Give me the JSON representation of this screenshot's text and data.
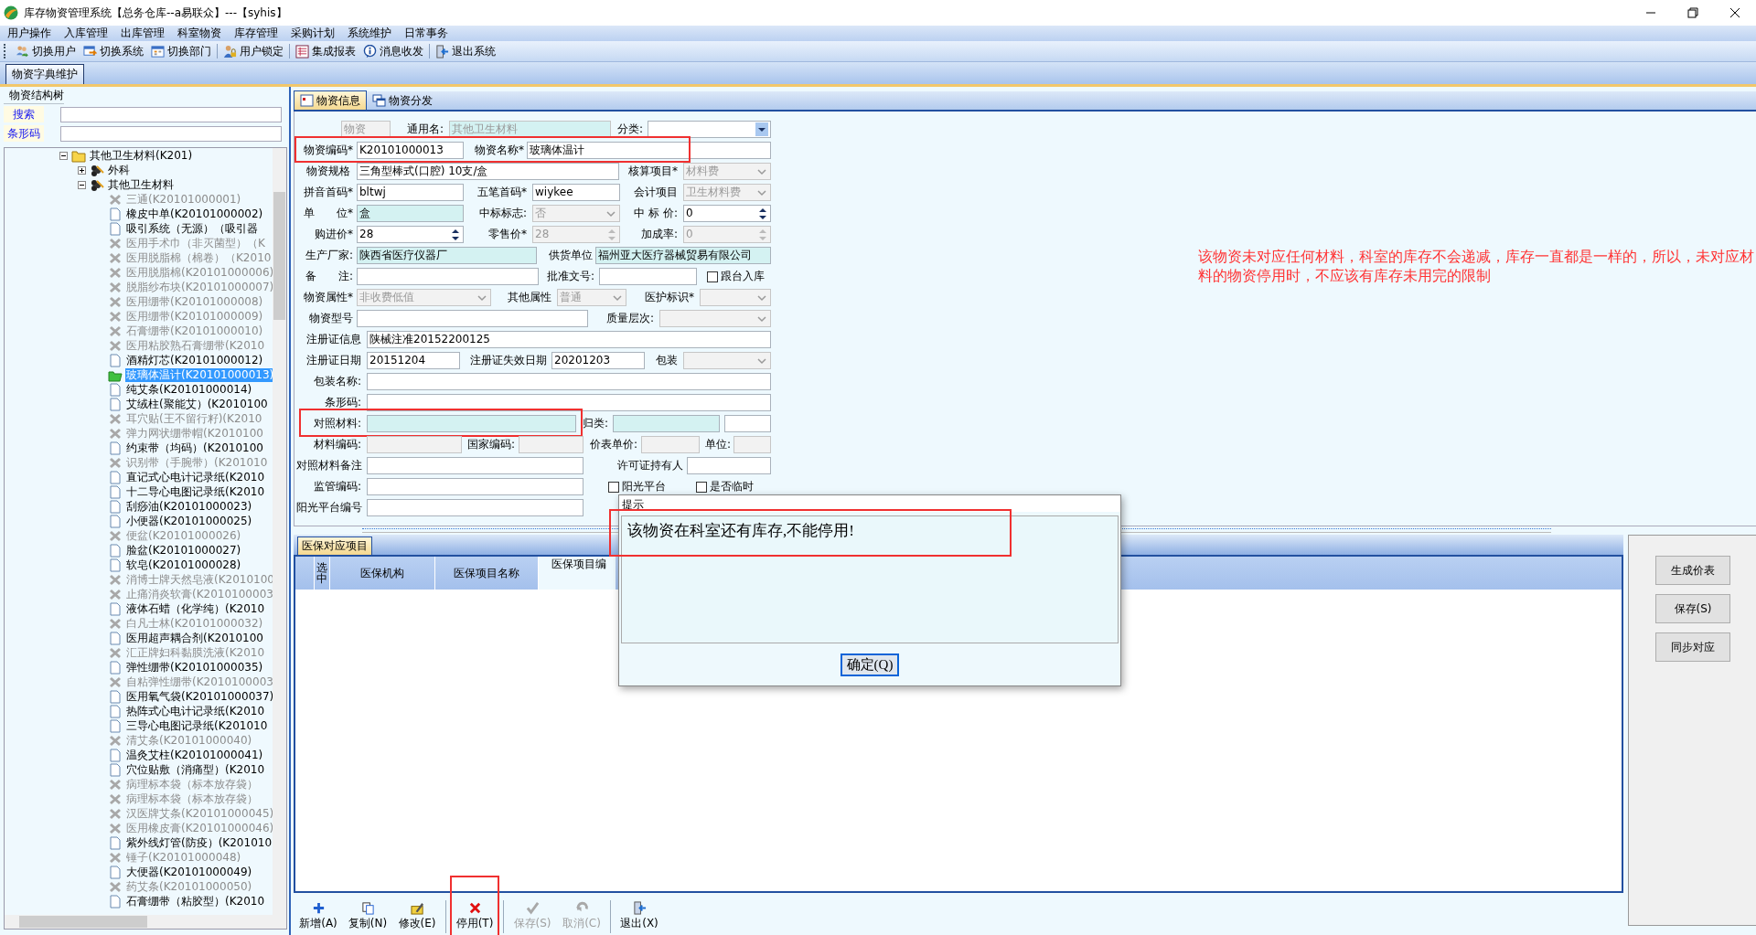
{
  "window": {
    "title": "库存物资管理系统【总务仓库--a易联众】---【syhis】"
  },
  "menu": [
    "用户操作",
    "入库管理",
    "出库管理",
    "科室物资",
    "库存管理",
    "采购计划",
    "系统维护",
    "日常事务"
  ],
  "toolbar": [
    {
      "label": "切换用户",
      "kind": "users"
    },
    {
      "label": "切换系统",
      "kind": "switch"
    },
    {
      "label": "切换部门",
      "kind": "calendar"
    },
    {
      "label": "用户锁定",
      "kind": "lock"
    },
    {
      "label": "集成报表",
      "kind": "report"
    },
    {
      "label": "消息收发",
      "kind": "info"
    },
    {
      "label": "退出系统",
      "kind": "exit"
    }
  ],
  "page_tabs": [
    {
      "label": "物资字典维护",
      "selected": true
    }
  ],
  "tree_panel": {
    "title": "物资结构树",
    "search_label": "搜索",
    "barcode_label": "条形码"
  },
  "tree": {
    "nodes": [
      {
        "label": "其他卫生材料(K201)",
        "kind": "folder",
        "expanded": true,
        "children": [
          {
            "label": "外科",
            "kind": "group",
            "expanded": false
          },
          {
            "label": "其他卫生材料",
            "kind": "group",
            "expanded": true,
            "children": [
              {
                "label": "三通(K20101000001)",
                "disabled": true,
                "selected": false
              },
              {
                "label": "橡皮中单(K20101000002)",
                "disabled": false,
                "selected": false
              },
              {
                "label": "吸引系统（无源）（吸引器",
                "disabled": false,
                "selected": false
              },
              {
                "label": "医用手术巾（非灭菌型）（K",
                "disabled": true,
                "selected": false
              },
              {
                "label": "医用脱脂棉（棉卷）（K2010",
                "disabled": true,
                "selected": false
              },
              {
                "label": "医用脱脂棉(K20101000006)",
                "disabled": true,
                "selected": false
              },
              {
                "label": "脱脂纱布块(K20101000007)",
                "disabled": true,
                "selected": false
              },
              {
                "label": "医用绷带(K20101000008)",
                "disabled": true,
                "selected": false
              },
              {
                "label": "医用绷带(K20101000009)",
                "disabled": true,
                "selected": false
              },
              {
                "label": "石膏绷带(K20101000010)",
                "disabled": true,
                "selected": false
              },
              {
                "label": "医用粘胶熟石膏绷带(K2010",
                "disabled": true,
                "selected": false
              },
              {
                "label": "酒精灯芯(K20101000012)",
                "disabled": false,
                "selected": false
              },
              {
                "label": "玻璃体温计(K20101000013)",
                "disabled": false,
                "selected": true
              },
              {
                "label": "纯艾条(K20101000014)",
                "disabled": false,
                "selected": false
              },
              {
                "label": "艾绒柱(聚能艾）(K2010100",
                "disabled": false,
                "selected": false
              },
              {
                "label": "耳穴贴(王不留行籽)(K2010",
                "disabled": true,
                "selected": false
              },
              {
                "label": "弹力网状绷带帽(K2010100",
                "disabled": true,
                "selected": false
              },
              {
                "label": "约束带（均码）(K2010100",
                "disabled": false,
                "selected": false
              },
              {
                "label": "识别带（手腕带）(K201010",
                "disabled": true,
                "selected": false
              },
              {
                "label": "直记式心电计记录纸(K2010",
                "disabled": false,
                "selected": false
              },
              {
                "label": "十二导心电图记录纸(K2010",
                "disabled": false,
                "selected": false
              },
              {
                "label": "刮痧油(K20101000023)",
                "disabled": false,
                "selected": false
              },
              {
                "label": "小便器(K20101000025)",
                "disabled": false,
                "selected": false
              },
              {
                "label": "便盆(K20101000026)",
                "disabled": true,
                "selected": false
              },
              {
                "label": "脸盆(K20101000027)",
                "disabled": false,
                "selected": false
              },
              {
                "label": "软皂(K20101000028)",
                "disabled": false,
                "selected": false
              },
              {
                "label": "消博士牌天然皂液(K2010100",
                "disabled": true,
                "selected": false
              },
              {
                "label": "止痛消炎软膏(K2010100003",
                "disabled": true,
                "selected": false
              },
              {
                "label": "液体石蜡（化学纯）(K2010",
                "disabled": false,
                "selected": false
              },
              {
                "label": "白凡士林(K20101000032)",
                "disabled": true,
                "selected": false
              },
              {
                "label": "医用超声耦合剂(K2010100",
                "disabled": false,
                "selected": false
              },
              {
                "label": "汇正牌妇科黏膜洗液(K2010",
                "disabled": true,
                "selected": false
              },
              {
                "label": "弹性绷带(K20101000035)",
                "disabled": false,
                "selected": false
              },
              {
                "label": "自粘弹性绷带(K2010100003",
                "disabled": true,
                "selected": false
              },
              {
                "label": "医用氧气袋(K20101000037)",
                "disabled": false,
                "selected": false
              },
              {
                "label": "热阵式心电计记录纸(K2010",
                "disabled": false,
                "selected": false
              },
              {
                "label": "三导心电图记录纸(K201010",
                "disabled": false,
                "selected": false
              },
              {
                "label": "清艾条(K20101000040)",
                "disabled": true,
                "selected": false
              },
              {
                "label": "温灸艾柱(K20101000041)",
                "disabled": false,
                "selected": false
              },
              {
                "label": "穴位贴敷（消痛型）(K2010",
                "disabled": false,
                "selected": false
              },
              {
                "label": "病理标本袋（标本放存袋）",
                "disabled": true,
                "selected": false
              },
              {
                "label": "病理标本袋（标本放存袋）",
                "disabled": true,
                "selected": false
              },
              {
                "label": "汉医牌艾条(K20101000045)",
                "disabled": true,
                "selected": false
              },
              {
                "label": "医用橡皮膏(K20101000046)",
                "disabled": true,
                "selected": false
              },
              {
                "label": "紫外线灯管(防疫）(K201010",
                "disabled": false,
                "selected": false
              },
              {
                "label": "锤子(K20101000048)",
                "disabled": true,
                "selected": false
              },
              {
                "label": "大便器(K20101000049)",
                "disabled": false,
                "selected": false
              },
              {
                "label": "药艾条(K20101000050)",
                "disabled": true,
                "selected": false
              },
              {
                "label": "石膏绷带（粘胶型）(K2010",
                "disabled": false,
                "selected": false
              }
            ]
          }
        ]
      }
    ]
  },
  "form_tabs": [
    {
      "label": "物资信息",
      "kind": "info",
      "selected": true
    },
    {
      "label": "物资分发",
      "kind": "copy",
      "selected": false
    }
  ],
  "form_rows": [
    {
      "cells": [
        {
          "kind": "text",
          "value": "物资",
          "disabled": true
        },
        {
          "kind": "label",
          "text": "通用名:"
        },
        {
          "kind": "lookup",
          "value": "其他卫生材料",
          "disabled": true
        },
        {
          "kind": "label",
          "text": "分类:"
        },
        {
          "kind": "combo",
          "disabled": false
        }
      ]
    },
    {
      "marked": true,
      "cells": [
        {
          "kind": "label",
          "text": "物资编码*"
        },
        {
          "kind": "text",
          "value": "K20101000013",
          "disabled": false
        },
        {
          "kind": "label",
          "text": "物资名称*"
        },
        {
          "kind": "text",
          "value": "玻璃体温计",
          "disabled": false
        }
      ]
    },
    {
      "cells": [
        {
          "kind": "label",
          "text": "物资规格"
        },
        {
          "kind": "text",
          "value": "三角型棒式(口腔) 10支/盒",
          "disabled": false
        },
        {
          "kind": "label",
          "text": "核算项目*"
        },
        {
          "kind": "combo",
          "value": "材料费",
          "disabled": true
        }
      ]
    },
    {
      "cells": [
        {
          "kind": "label",
          "text": "拼音首码*"
        },
        {
          "kind": "text",
          "value": "bltwj",
          "disabled": false
        },
        {
          "kind": "label",
          "text": "五笔首码*"
        },
        {
          "kind": "text",
          "value": "wiykee",
          "disabled": false
        },
        {
          "kind": "label",
          "text": "会计项目"
        },
        {
          "kind": "combo",
          "value": "卫生材料费",
          "disabled": true
        }
      ]
    },
    {
      "cells": [
        {
          "kind": "label",
          "text": "单　　位*"
        },
        {
          "kind": "lookup",
          "value": "盒",
          "disabled": false
        },
        {
          "kind": "label",
          "text": "中标标志:"
        },
        {
          "kind": "combo",
          "value": "否",
          "disabled": true
        },
        {
          "kind": "label",
          "text": "中 标 价:"
        },
        {
          "kind": "spin",
          "value": "0",
          "disabled": false
        }
      ]
    },
    {
      "cells": [
        {
          "kind": "label",
          "text": "购进价*"
        },
        {
          "kind": "spin",
          "value": "28",
          "disabled": false
        },
        {
          "kind": "label",
          "text": "零售价*"
        },
        {
          "kind": "spin",
          "value": "28",
          "disabled": true
        },
        {
          "kind": "label",
          "text": "加成率:"
        },
        {
          "kind": "spin",
          "value": "0",
          "disabled": true
        }
      ]
    },
    {
      "cells": [
        {
          "kind": "label",
          "text": "生产厂家:"
        },
        {
          "kind": "lookup",
          "value": "陕西省医疗仪器厂",
          "disabled": false
        },
        {
          "kind": "label",
          "text": "供货单位"
        },
        {
          "kind": "lookup",
          "value": "福州亚大医疗器械贸易有限公司",
          "disabled": false
        }
      ]
    },
    {
      "cells": [
        {
          "kind": "label",
          "text": "备　　注:"
        },
        {
          "kind": "text",
          "disabled": false
        },
        {
          "kind": "label",
          "text": "批准文号:"
        },
        {
          "kind": "text",
          "disabled": false
        },
        {
          "kind": "check",
          "text": "跟台入库",
          "checked": false
        }
      ]
    },
    {
      "cells": [
        {
          "kind": "label",
          "text": "物资属性*"
        },
        {
          "kind": "combo",
          "value": "非收费低值",
          "disabled": true
        },
        {
          "kind": "label",
          "text": "其他属性"
        },
        {
          "kind": "combo",
          "value": "普通",
          "disabled": true
        },
        {
          "kind": "label",
          "text": "医护标识*"
        },
        {
          "kind": "combo",
          "disabled": true
        }
      ]
    },
    {
      "cells": [
        {
          "kind": "label",
          "text": "物资型号"
        },
        {
          "kind": "text",
          "disabled": false
        },
        {
          "kind": "label",
          "text": "质量层次:"
        },
        {
          "kind": "combo",
          "disabled": true
        }
      ]
    },
    {
      "cells": [
        {
          "kind": "label",
          "text": "注册证信息"
        },
        {
          "kind": "text",
          "value": "陕械注准20152200125",
          "disabled": false
        }
      ]
    },
    {
      "cells": [
        {
          "kind": "label",
          "text": "注册证日期"
        },
        {
          "kind": "text",
          "value": "20151204",
          "disabled": false
        },
        {
          "kind": "label",
          "text": "注册证失效日期"
        },
        {
          "kind": "text",
          "value": "20201203",
          "disabled": false
        },
        {
          "kind": "label",
          "text": "包装"
        },
        {
          "kind": "combo",
          "disabled": true
        }
      ]
    },
    {
      "cells": [
        {
          "kind": "label",
          "text": "包装名称:"
        },
        {
          "kind": "text",
          "disabled": false
        }
      ]
    },
    {
      "cells": [
        {
          "kind": "label",
          "text": "条形码:"
        },
        {
          "kind": "text",
          "disabled": false
        }
      ]
    },
    {
      "marked": true,
      "cells": [
        {
          "kind": "label",
          "text": "对照材料:"
        },
        {
          "kind": "lookup",
          "disabled": false
        },
        {
          "kind": "label",
          "text": "归类:"
        },
        {
          "kind": "lookup",
          "disabled": false
        },
        {
          "kind": "text",
          "disabled": false
        }
      ]
    },
    {
      "cells": [
        {
          "kind": "label",
          "text": "材料编码:"
        },
        {
          "kind": "text",
          "disabled": true
        },
        {
          "kind": "label",
          "text": "国家编码:"
        },
        {
          "kind": "text",
          "disabled": true
        },
        {
          "kind": "label",
          "text": "价表单价:"
        },
        {
          "kind": "text",
          "disabled": true
        },
        {
          "kind": "label",
          "text": "单位:"
        },
        {
          "kind": "text",
          "disabled": true
        }
      ]
    },
    {
      "cells": [
        {
          "kind": "label",
          "text": "对照材料备注"
        },
        {
          "kind": "text",
          "disabled": false
        },
        {
          "kind": "label",
          "text": "许可证持有人"
        },
        {
          "kind": "text",
          "disabled": false
        }
      ]
    },
    {
      "cells": [
        {
          "kind": "label",
          "text": "监管编码:"
        },
        {
          "kind": "text",
          "disabled": false
        },
        {
          "kind": "check",
          "text": "阳光平台",
          "checked": false
        },
        {
          "kind": "check",
          "text": "是否临时",
          "checked": false
        }
      ]
    },
    {
      "cells": [
        {
          "kind": "label",
          "text": "阳光平台编号"
        },
        {
          "kind": "text",
          "disabled": false
        }
      ]
    }
  ],
  "note": "该物资未对应任何材料，科室的库存不会递减，库存一直都是一样的，所以，未对应材料的物资停用时，不应该有库存未用完的限制",
  "lower_tabs": [
    {
      "label": "医保对应项目",
      "selected": true
    }
  ],
  "grid": {
    "columns": [
      "选中",
      "医保机构",
      "医保项目名称",
      "医保项目编"
    ]
  },
  "side_buttons": [
    "生成价表",
    "保存(S)",
    "同步对应"
  ],
  "actions": [
    {
      "label": "新增(A)",
      "kind": "add",
      "disabled": false
    },
    {
      "label": "复制(N)",
      "kind": "copy",
      "disabled": false
    },
    {
      "label": "修改(E)",
      "kind": "edit",
      "disabled": false
    },
    {
      "label": "停用(T)",
      "kind": "stop",
      "disabled": false,
      "marked": true
    },
    {
      "label": "保存(S)",
      "kind": "save",
      "disabled": true
    },
    {
      "label": "取消(C)",
      "kind": "cancel",
      "disabled": true
    },
    {
      "label": "退出(X)",
      "kind": "exit",
      "disabled": false
    }
  ],
  "dialog": {
    "title": "提示",
    "message": "该物资在科室还有库存,不能停用!",
    "button": "确定(Q)",
    "marked": true
  }
}
